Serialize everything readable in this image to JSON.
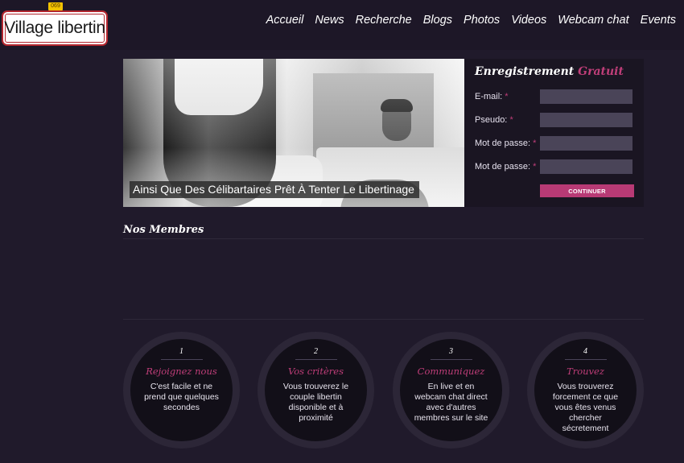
{
  "header": {
    "logo_text": "Village libertin",
    "logo_badge": "069",
    "nav": [
      "Accueil",
      "News",
      "Recherche",
      "Blogs",
      "Photos",
      "Videos",
      "Webcam chat",
      "Events"
    ]
  },
  "hero": {
    "caption": "Ainsi Que Des Célibartaires Prêt À Tenter Le Libertinage"
  },
  "registration": {
    "title_main": "Enregistrement",
    "title_accent": "Gratuit",
    "fields": [
      {
        "label": "E-mail:",
        "required": "*",
        "value": ""
      },
      {
        "label": "Pseudo:",
        "required": "*",
        "value": ""
      },
      {
        "label": "Mot de passe:",
        "required": "*",
        "value": ""
      },
      {
        "label": "Mot de passe:",
        "required": "*",
        "value": ""
      }
    ],
    "submit_label": "CONTINUER"
  },
  "members": {
    "title": "Nos Membres"
  },
  "steps": [
    {
      "num": "1",
      "title": "Rejoignez nous",
      "desc": "C'est facile et ne prend que quelques secondes"
    },
    {
      "num": "2",
      "title": "Vos critères",
      "desc": "Vous trouverez le couple libertin disponible et à proximité"
    },
    {
      "num": "3",
      "title": "Communiquez",
      "desc": "En live et en webcam chat direct avec d'autres membres sur le site"
    },
    {
      "num": "4",
      "title": "Trouvez",
      "desc": "Vous trouverez forcement ce que vous êtes venus chercher sécretement"
    }
  ],
  "colors": {
    "background": "#201a2b",
    "accent": "#c03e79",
    "button": "#b83a75",
    "input": "#4a4458"
  }
}
